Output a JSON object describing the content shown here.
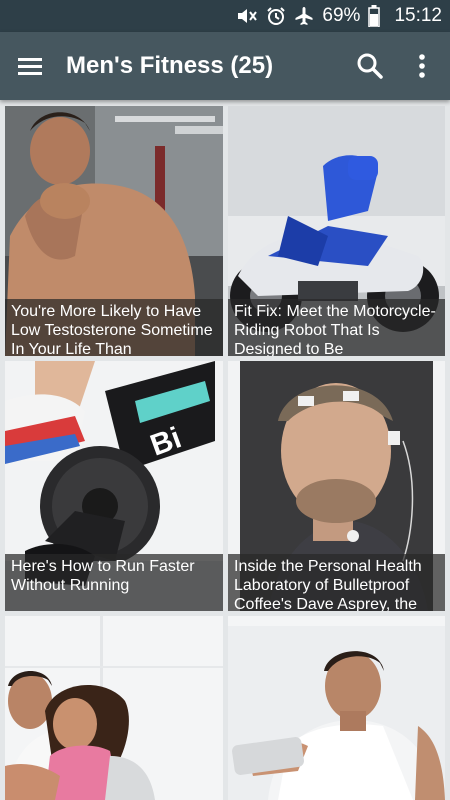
{
  "status_bar": {
    "battery_percent": "69%",
    "time": "15:12",
    "icons": [
      "mute-icon",
      "alarm-icon",
      "airplane-icon",
      "battery-icon"
    ]
  },
  "app_bar": {
    "title": "Men's Fitness (25)",
    "icons": [
      "hamburger-menu-icon",
      "search-icon",
      "more-vert-icon"
    ]
  },
  "articles": [
    {
      "caption": "You're More Likely to Have Low Testosterone Sometime In Your Life Than"
    },
    {
      "caption": "Fit Fix: Meet the Motorcycle-Riding Robot That Is Designed to Be"
    },
    {
      "caption": "Here's How to Run Faster Without Running"
    },
    {
      "caption": "Inside the Personal Health Laboratory of Bulletproof Coffee's Dave Asprey, the"
    },
    {
      "caption": ""
    },
    {
      "caption": ""
    }
  ]
}
